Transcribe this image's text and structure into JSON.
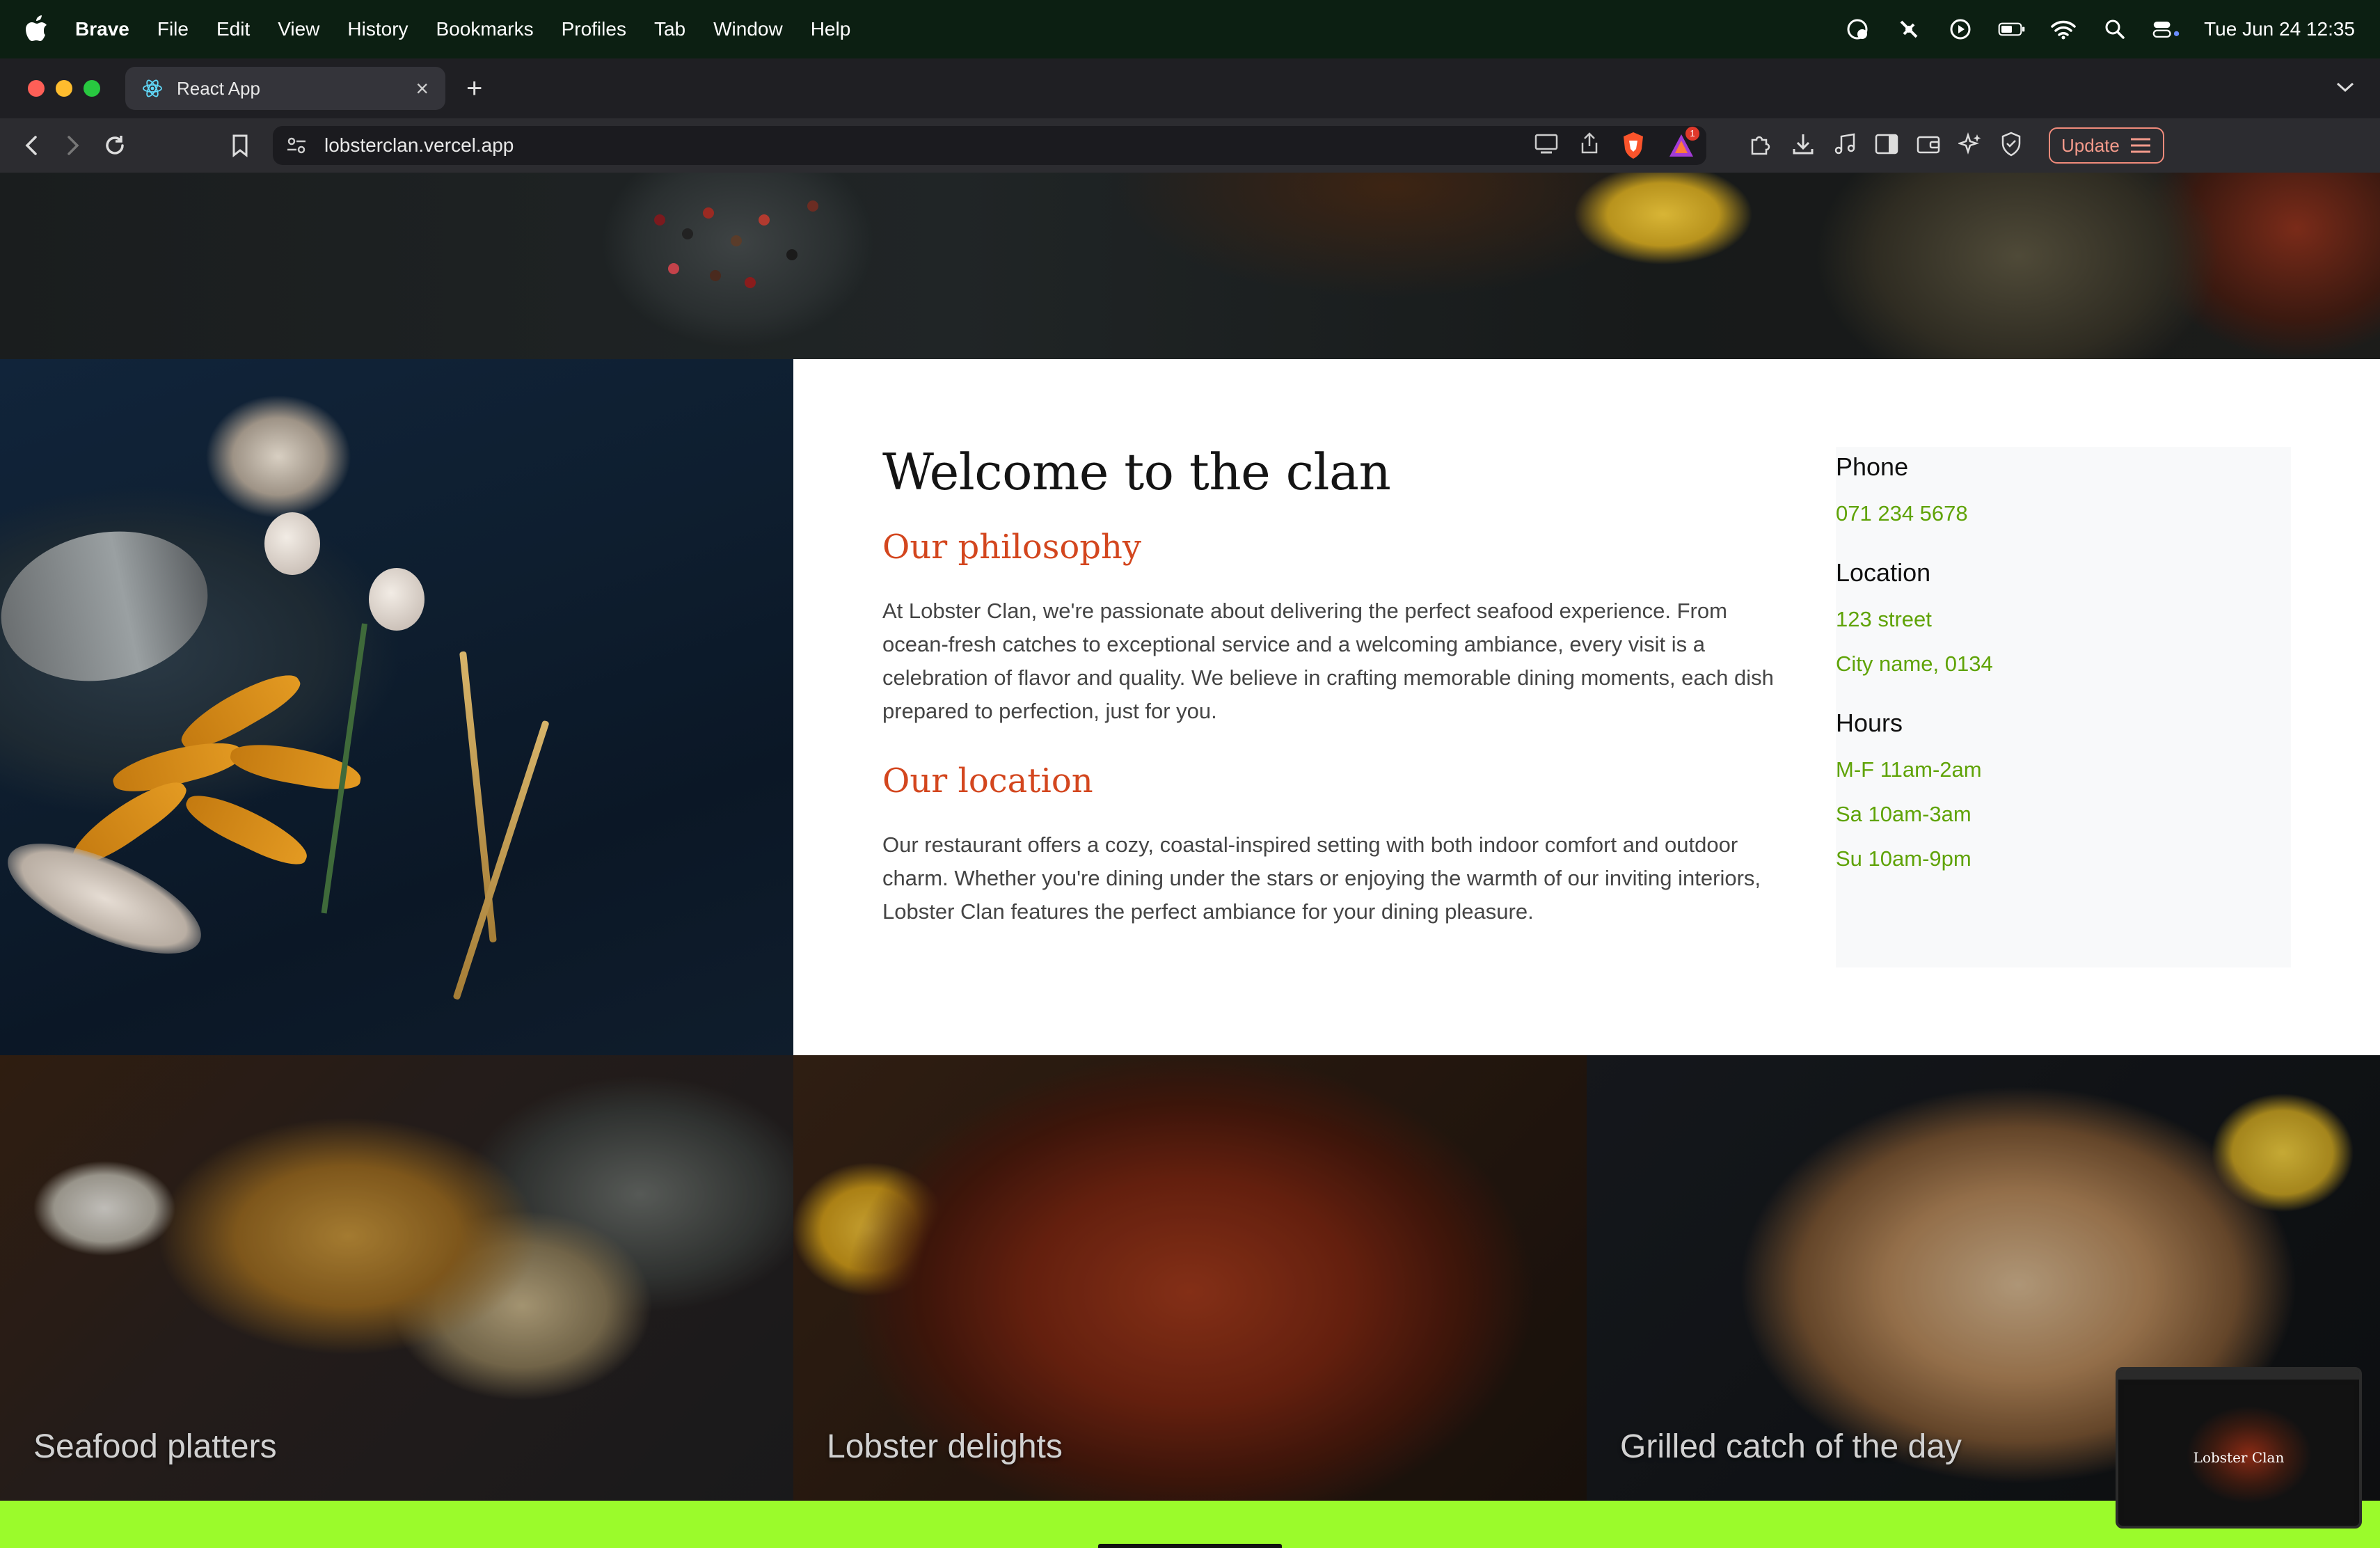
{
  "menubar": {
    "app_name": "Brave",
    "items": [
      "File",
      "Edit",
      "View",
      "History",
      "Bookmarks",
      "Profiles",
      "Tab",
      "Window",
      "Help"
    ],
    "clock": "Tue Jun 24  12:35"
  },
  "browser": {
    "tab_title": "React App",
    "url": "lobsterclan.vercel.app",
    "update_label": "Update",
    "rewards_badge": "1"
  },
  "welcome": {
    "title": "Welcome to the clan",
    "philosophy_heading": "Our philosophy",
    "philosophy_text": "At Lobster Clan, we're passionate about delivering the perfect seafood experience. From ocean-fresh catches to exceptional service and a welcoming ambiance, every visit is a celebration of flavor and quality. We believe in crafting memorable dining moments, each dish prepared to perfection, just for you.",
    "location_heading": "Our location",
    "location_text": "Our restaurant offers a cozy, coastal-inspired setting with both indoor comfort and outdoor charm. Whether you're dining under the stars or enjoying the warmth of our inviting interiors, Lobster Clan features the perfect ambiance for your dining pleasure."
  },
  "info": {
    "phone_label": "Phone",
    "phone": "071 234 5678",
    "location_label": "Location",
    "street": "123 street",
    "city": "City name, 0134",
    "hours_label": "Hours",
    "hours": [
      "M-F 11am-2am",
      "Sa 10am-3am",
      "Su 10am-9pm"
    ]
  },
  "gallery": [
    "Seafood platters",
    "Lobster delights",
    "Grilled catch of the day"
  ],
  "preview": {
    "title": "Lobster Clan"
  },
  "colors": {
    "accent_red": "#d3461e",
    "accent_green": "#5fa306",
    "footer_lime": "#9bfb2b"
  }
}
